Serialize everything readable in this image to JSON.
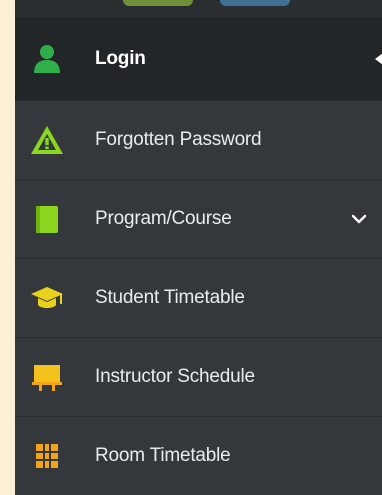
{
  "menu": {
    "items": [
      {
        "label": "Login",
        "icon": "user-icon",
        "active": true
      },
      {
        "label": "Forgotten Password",
        "icon": "warning-triangle-icon"
      },
      {
        "label": "Program/Course",
        "icon": "book-icon",
        "has_submenu": true
      },
      {
        "label": "Student Timetable",
        "icon": "graduation-cap-icon"
      },
      {
        "label": "Instructor Schedule",
        "icon": "presentation-board-icon"
      },
      {
        "label": "Room Timetable",
        "icon": "grid-icon"
      }
    ]
  },
  "colors": {
    "page_background": "#fbf0d6",
    "menu_background": "#34383c",
    "active_background": "#232629",
    "text": "#e9ecee",
    "icon_green": "#2fae4a",
    "icon_lime": "#8bd61e",
    "icon_yellow": "#f3c21c",
    "icon_orange": "#f2a51a"
  }
}
